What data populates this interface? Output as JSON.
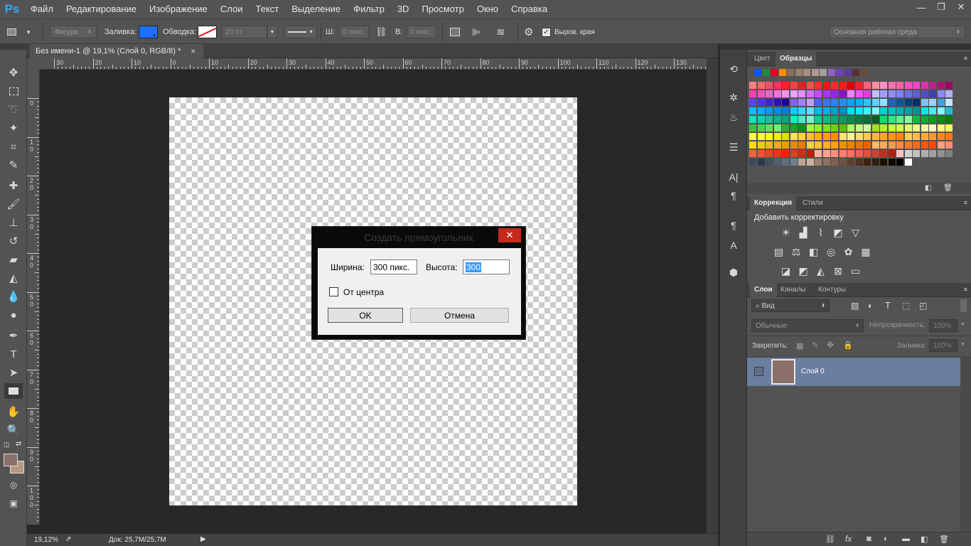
{
  "app": {
    "logo": "Ps"
  },
  "menu": [
    "Файл",
    "Редактирование",
    "Изображение",
    "Слои",
    "Текст",
    "Выделение",
    "Фильтр",
    "3D",
    "Просмотр",
    "Окно",
    "Справка"
  ],
  "window_controls": {
    "minimize": "—",
    "restore": "❐",
    "close": "✕"
  },
  "options": {
    "shape_mode": "Фигура",
    "fill_label": "Заливка:",
    "fill_color": "#1f6fff",
    "stroke_label": "Обводка:",
    "stroke_width": "20 пт",
    "w_label": "Ш:",
    "w_value": "0 пикс.",
    "h_label": "В:",
    "h_value": "0 пикс.",
    "align_edges_label": "Выров. края",
    "workspace": "Основная рабочая среда"
  },
  "document": {
    "tab_title": "Без имени-1 @ 19,1% (Слой 0, RGB/8) *",
    "close_icon": "×",
    "h_ruler_ticks": [
      "30",
      "20",
      "10",
      "0",
      "10",
      "20",
      "30",
      "40",
      "50",
      "60",
      "70",
      "80",
      "90",
      "100",
      "110",
      "120",
      "130"
    ],
    "v_ruler_ticks": [
      "0",
      "1\n0",
      "2\n0",
      "3\n0",
      "4\n0",
      "5\n0",
      "6\n0",
      "7\n0",
      "8\n0",
      "9\n0",
      "1\n0\n0"
    ]
  },
  "status": {
    "zoom": "19,12%",
    "doc_info": "Док: 25,7M/25,7M"
  },
  "panels": {
    "color_tabs": [
      "Цвет",
      "Образцы"
    ],
    "adjust_tabs": [
      "Коррекция",
      "Стили"
    ],
    "adjust_title": "Добавить корректировку",
    "layers_tabs": [
      "Слои",
      "Каналы",
      "Контуры"
    ],
    "layers_filter": "Вид",
    "blend_mode": "Обычные",
    "opacity_label": "Непрозрачность:",
    "opacity_value": "100%",
    "lock_label": "Закрепить:",
    "fill_label": "Заливка:",
    "fill_value": "100%",
    "layer_name": "Слой 0",
    "layer_thumb_color": "#8a7068"
  },
  "dialog": {
    "title": "Создать прямоугольник",
    "close": "✕",
    "width_label": "Ширина:",
    "width_value": "300 пикс.",
    "height_label": "Высота:",
    "height_value": "300",
    "from_center_label": "От центра",
    "ok_label": "OK",
    "cancel_label": "Отмена"
  }
}
